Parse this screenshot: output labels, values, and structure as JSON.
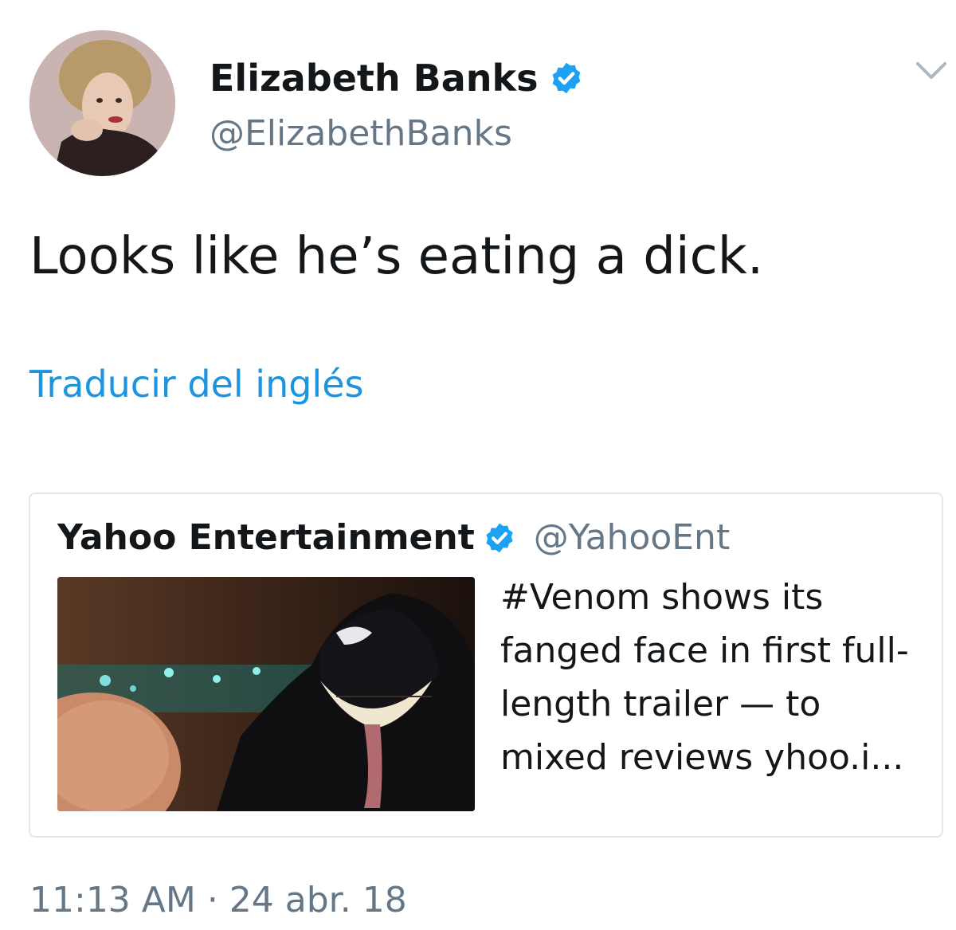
{
  "author": {
    "display_name": "Elizabeth Banks",
    "handle": "@ElizabethBanks",
    "verified": true,
    "avatar": "profile-photo"
  },
  "tweet": {
    "text": "Looks like he’s eating a dick.",
    "translate_label": "Traducir del inglés",
    "timestamp": "11:13 AM · 24 abr. 18"
  },
  "quoted_tweet": {
    "display_name": "Yahoo Entertainment",
    "handle": "@YahooEnt",
    "verified": true,
    "text": "#Venom shows its fanged face in first full-length trailer — to mixed reviews yhoo.i...",
    "media": "venom-still-image"
  },
  "icons": {
    "verified": "verified-badge-icon",
    "caret": "chevron-down-icon"
  },
  "colors": {
    "link_blue": "#1b95e0",
    "verified_blue": "#1da1f2",
    "secondary_gray": "#657786",
    "primary_text": "#14171a",
    "border": "#e1e8ed"
  }
}
